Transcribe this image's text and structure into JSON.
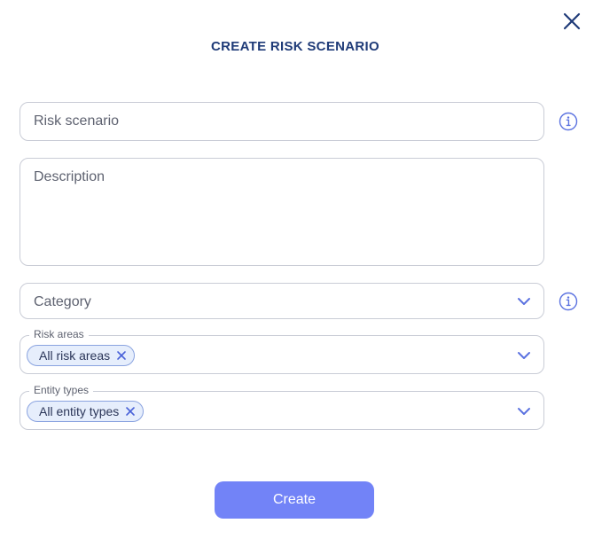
{
  "dialog": {
    "title": "CREATE RISK SCENARIO",
    "close_icon": "close-icon"
  },
  "form": {
    "risk_scenario": {
      "placeholder": "Risk scenario",
      "value": "",
      "info_icon": "info-icon"
    },
    "description": {
      "placeholder": "Description",
      "value": ""
    },
    "category": {
      "placeholder": "Category",
      "selected": "",
      "info_icon": "info-icon",
      "dropdown_icon": "chevron-down-icon"
    },
    "risk_areas": {
      "label": "Risk areas",
      "chips": [
        "All risk areas"
      ],
      "dropdown_icon": "chevron-down-icon"
    },
    "entity_types": {
      "label": "Entity types",
      "chips": [
        "All entity types"
      ],
      "dropdown_icon": "chevron-down-icon"
    }
  },
  "actions": {
    "create_label": "Create"
  },
  "colors": {
    "title": "#1f3b78",
    "accent": "#7283f7",
    "chip_bg": "#e6eefc",
    "chip_border": "#8aa3e0",
    "icon": "#5b72e0",
    "border": "#c9ccd6"
  }
}
